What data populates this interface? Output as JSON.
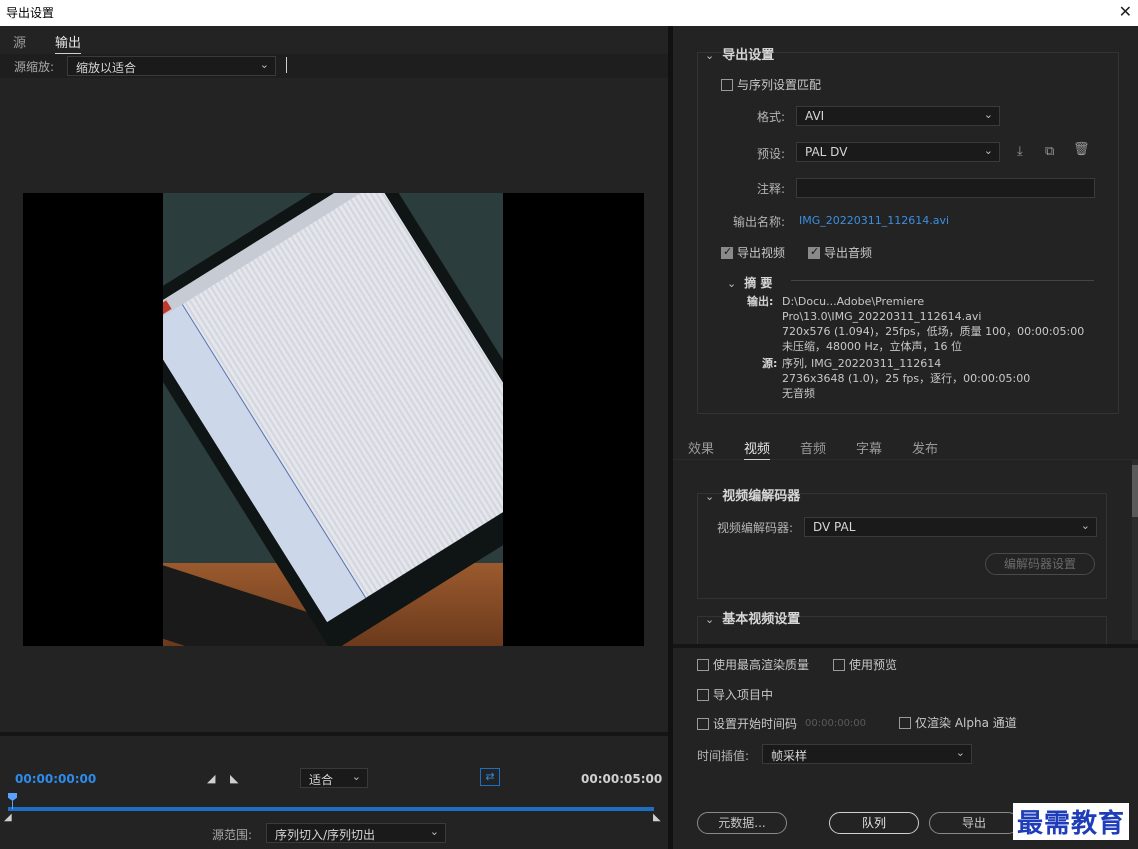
{
  "window": {
    "title": "导出设置",
    "close_glyph": "✕"
  },
  "left": {
    "tabs": [
      {
        "label": "源"
      },
      {
        "label": "输出"
      }
    ],
    "source_zoom_label": "源缩放:",
    "source_zoom_value": "缩放以适合",
    "timeline": {
      "current_tc": "00:00:00:00",
      "end_tc": "00:00:05:00",
      "fit_value": "适合",
      "range_label": "源范围:",
      "range_value": "序列切入/序列切出"
    }
  },
  "export_settings": {
    "title": "导出设置",
    "match_sequence_label": "与序列设置匹配",
    "format_label": "格式:",
    "format_value": "AVI",
    "preset_label": "预设:",
    "preset_value": "PAL DV",
    "comment_label": "注释:",
    "comment_value": "",
    "output_name_label": "输出名称:",
    "output_name_value": "IMG_20220311_112614.avi",
    "export_video_label": "导出视频",
    "export_audio_label": "导出音频",
    "summary": {
      "title": "摘 要",
      "output_key": "输出:",
      "output_lines": [
        "D:\\Docu...Adobe\\Premiere Pro\\13.0\\IMG_20220311_112614.avi",
        "720x576 (1.094)，25fps，低场，质量 100，00:00:05:00",
        "未压缩，48000 Hz，立体声，16 位"
      ],
      "source_key": "源:",
      "source_lines": [
        "序列, IMG_20220311_112614",
        "2736x3648 (1.0)，25 fps，逐行，00:00:05:00",
        "无音频"
      ]
    }
  },
  "mid_tabs": [
    {
      "label": "效果"
    },
    {
      "label": "视频"
    },
    {
      "label": "音频"
    },
    {
      "label": "字幕"
    },
    {
      "label": "发布"
    }
  ],
  "video_codec": {
    "title": "视频编解码器",
    "codec_label": "视频编解码器:",
    "codec_value": "DV PAL",
    "codec_settings_btn": "编解码器设置"
  },
  "basic_video": {
    "title": "基本视频设置"
  },
  "bottom": {
    "max_render_quality": "使用最高渲染质量",
    "use_previews": "使用预览",
    "import_into_project": "导入项目中",
    "set_start_tc": "设置开始时间码",
    "start_tc_value": "00:00:00:00",
    "render_alpha_only": "仅渲染 Alpha 通道",
    "time_interp_label": "时间插值:",
    "time_interp_value": "帧采样",
    "metadata_btn": "元数据...",
    "queue_btn": "队列",
    "export_btn": "导出"
  },
  "watermark": "最需教育",
  "colors": {
    "accent_blue": "#2d8ceb",
    "panel_bg": "#232323",
    "watermark": "#1f3db8"
  }
}
